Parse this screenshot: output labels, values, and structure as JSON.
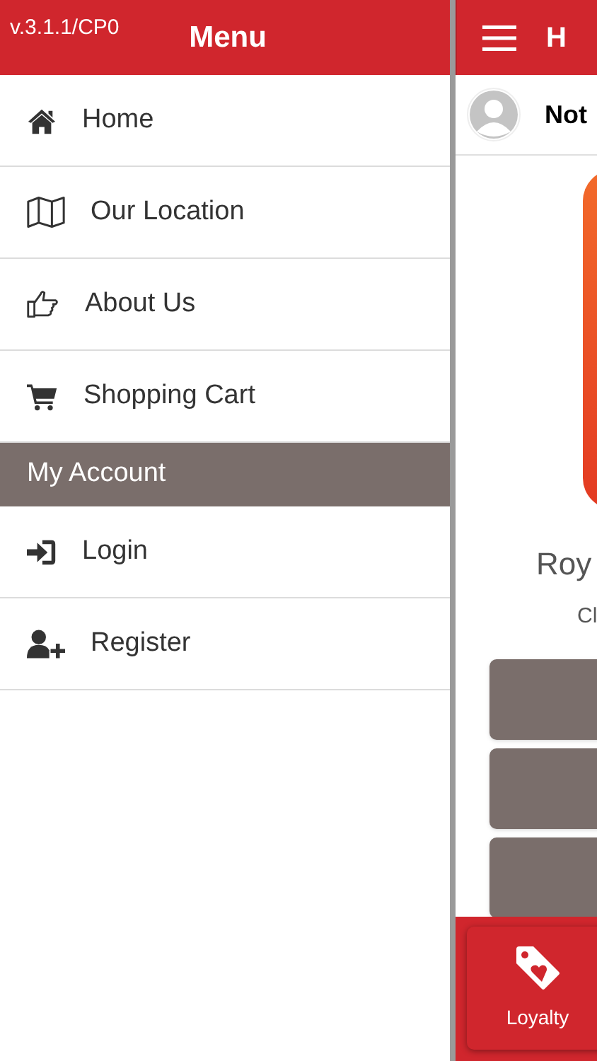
{
  "drawer": {
    "version": "v.3.1.1/CP0",
    "title": "Menu",
    "items": [
      {
        "label": "Home"
      },
      {
        "label": "Our Location"
      },
      {
        "label": "About Us"
      },
      {
        "label": "Shopping Cart"
      }
    ],
    "section": {
      "title": "My Account",
      "items": [
        {
          "label": "Login"
        },
        {
          "label": "Register"
        }
      ]
    }
  },
  "main": {
    "title": "H",
    "user_name": "Not",
    "store_name": "Roy",
    "store_subtitle": "Cl",
    "bottom_nav": [
      {
        "label": "Loyalty"
      }
    ]
  }
}
